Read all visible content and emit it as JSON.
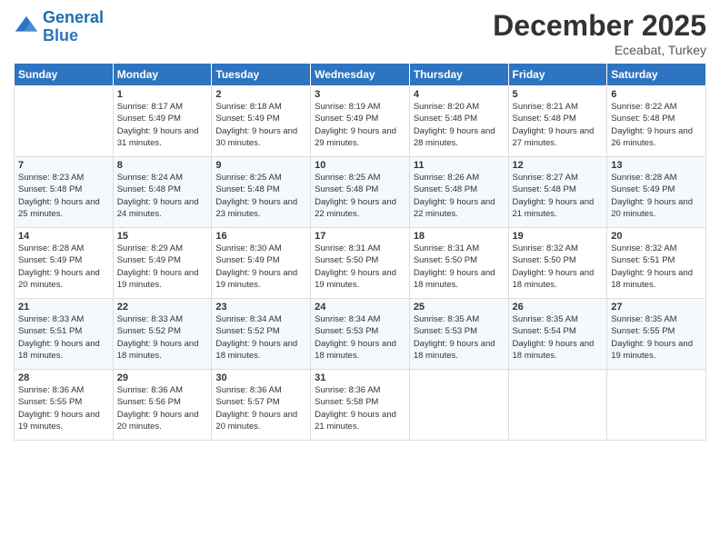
{
  "header": {
    "logo_general": "General",
    "logo_blue": "Blue",
    "month_title": "December 2025",
    "subtitle": "Eceabat, Turkey"
  },
  "days_of_week": [
    "Sunday",
    "Monday",
    "Tuesday",
    "Wednesday",
    "Thursday",
    "Friday",
    "Saturday"
  ],
  "weeks": [
    [
      {
        "day": "",
        "sunrise": "",
        "sunset": "",
        "daylight": ""
      },
      {
        "day": "1",
        "sunrise": "Sunrise: 8:17 AM",
        "sunset": "Sunset: 5:49 PM",
        "daylight": "Daylight: 9 hours and 31 minutes."
      },
      {
        "day": "2",
        "sunrise": "Sunrise: 8:18 AM",
        "sunset": "Sunset: 5:49 PM",
        "daylight": "Daylight: 9 hours and 30 minutes."
      },
      {
        "day": "3",
        "sunrise": "Sunrise: 8:19 AM",
        "sunset": "Sunset: 5:49 PM",
        "daylight": "Daylight: 9 hours and 29 minutes."
      },
      {
        "day": "4",
        "sunrise": "Sunrise: 8:20 AM",
        "sunset": "Sunset: 5:48 PM",
        "daylight": "Daylight: 9 hours and 28 minutes."
      },
      {
        "day": "5",
        "sunrise": "Sunrise: 8:21 AM",
        "sunset": "Sunset: 5:48 PM",
        "daylight": "Daylight: 9 hours and 27 minutes."
      },
      {
        "day": "6",
        "sunrise": "Sunrise: 8:22 AM",
        "sunset": "Sunset: 5:48 PM",
        "daylight": "Daylight: 9 hours and 26 minutes."
      }
    ],
    [
      {
        "day": "7",
        "sunrise": "Sunrise: 8:23 AM",
        "sunset": "Sunset: 5:48 PM",
        "daylight": "Daylight: 9 hours and 25 minutes."
      },
      {
        "day": "8",
        "sunrise": "Sunrise: 8:24 AM",
        "sunset": "Sunset: 5:48 PM",
        "daylight": "Daylight: 9 hours and 24 minutes."
      },
      {
        "day": "9",
        "sunrise": "Sunrise: 8:25 AM",
        "sunset": "Sunset: 5:48 PM",
        "daylight": "Daylight: 9 hours and 23 minutes."
      },
      {
        "day": "10",
        "sunrise": "Sunrise: 8:25 AM",
        "sunset": "Sunset: 5:48 PM",
        "daylight": "Daylight: 9 hours and 22 minutes."
      },
      {
        "day": "11",
        "sunrise": "Sunrise: 8:26 AM",
        "sunset": "Sunset: 5:48 PM",
        "daylight": "Daylight: 9 hours and 22 minutes."
      },
      {
        "day": "12",
        "sunrise": "Sunrise: 8:27 AM",
        "sunset": "Sunset: 5:48 PM",
        "daylight": "Daylight: 9 hours and 21 minutes."
      },
      {
        "day": "13",
        "sunrise": "Sunrise: 8:28 AM",
        "sunset": "Sunset: 5:49 PM",
        "daylight": "Daylight: 9 hours and 20 minutes."
      }
    ],
    [
      {
        "day": "14",
        "sunrise": "Sunrise: 8:28 AM",
        "sunset": "Sunset: 5:49 PM",
        "daylight": "Daylight: 9 hours and 20 minutes."
      },
      {
        "day": "15",
        "sunrise": "Sunrise: 8:29 AM",
        "sunset": "Sunset: 5:49 PM",
        "daylight": "Daylight: 9 hours and 19 minutes."
      },
      {
        "day": "16",
        "sunrise": "Sunrise: 8:30 AM",
        "sunset": "Sunset: 5:49 PM",
        "daylight": "Daylight: 9 hours and 19 minutes."
      },
      {
        "day": "17",
        "sunrise": "Sunrise: 8:31 AM",
        "sunset": "Sunset: 5:50 PM",
        "daylight": "Daylight: 9 hours and 19 minutes."
      },
      {
        "day": "18",
        "sunrise": "Sunrise: 8:31 AM",
        "sunset": "Sunset: 5:50 PM",
        "daylight": "Daylight: 9 hours and 18 minutes."
      },
      {
        "day": "19",
        "sunrise": "Sunrise: 8:32 AM",
        "sunset": "Sunset: 5:50 PM",
        "daylight": "Daylight: 9 hours and 18 minutes."
      },
      {
        "day": "20",
        "sunrise": "Sunrise: 8:32 AM",
        "sunset": "Sunset: 5:51 PM",
        "daylight": "Daylight: 9 hours and 18 minutes."
      }
    ],
    [
      {
        "day": "21",
        "sunrise": "Sunrise: 8:33 AM",
        "sunset": "Sunset: 5:51 PM",
        "daylight": "Daylight: 9 hours and 18 minutes."
      },
      {
        "day": "22",
        "sunrise": "Sunrise: 8:33 AM",
        "sunset": "Sunset: 5:52 PM",
        "daylight": "Daylight: 9 hours and 18 minutes."
      },
      {
        "day": "23",
        "sunrise": "Sunrise: 8:34 AM",
        "sunset": "Sunset: 5:52 PM",
        "daylight": "Daylight: 9 hours and 18 minutes."
      },
      {
        "day": "24",
        "sunrise": "Sunrise: 8:34 AM",
        "sunset": "Sunset: 5:53 PM",
        "daylight": "Daylight: 9 hours and 18 minutes."
      },
      {
        "day": "25",
        "sunrise": "Sunrise: 8:35 AM",
        "sunset": "Sunset: 5:53 PM",
        "daylight": "Daylight: 9 hours and 18 minutes."
      },
      {
        "day": "26",
        "sunrise": "Sunrise: 8:35 AM",
        "sunset": "Sunset: 5:54 PM",
        "daylight": "Daylight: 9 hours and 18 minutes."
      },
      {
        "day": "27",
        "sunrise": "Sunrise: 8:35 AM",
        "sunset": "Sunset: 5:55 PM",
        "daylight": "Daylight: 9 hours and 19 minutes."
      }
    ],
    [
      {
        "day": "28",
        "sunrise": "Sunrise: 8:36 AM",
        "sunset": "Sunset: 5:55 PM",
        "daylight": "Daylight: 9 hours and 19 minutes."
      },
      {
        "day": "29",
        "sunrise": "Sunrise: 8:36 AM",
        "sunset": "Sunset: 5:56 PM",
        "daylight": "Daylight: 9 hours and 20 minutes."
      },
      {
        "day": "30",
        "sunrise": "Sunrise: 8:36 AM",
        "sunset": "Sunset: 5:57 PM",
        "daylight": "Daylight: 9 hours and 20 minutes."
      },
      {
        "day": "31",
        "sunrise": "Sunrise: 8:36 AM",
        "sunset": "Sunset: 5:58 PM",
        "daylight": "Daylight: 9 hours and 21 minutes."
      },
      {
        "day": "",
        "sunrise": "",
        "sunset": "",
        "daylight": ""
      },
      {
        "day": "",
        "sunrise": "",
        "sunset": "",
        "daylight": ""
      },
      {
        "day": "",
        "sunrise": "",
        "sunset": "",
        "daylight": ""
      }
    ]
  ]
}
